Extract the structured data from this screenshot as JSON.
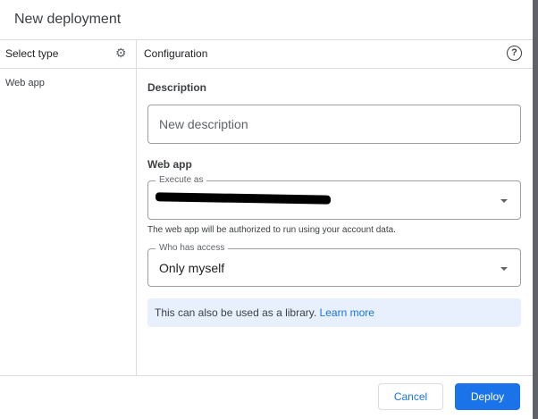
{
  "dialog": {
    "title": "New deployment"
  },
  "sidebar": {
    "header": "Select type",
    "items": [
      {
        "label": "Web app"
      }
    ]
  },
  "config": {
    "header": "Configuration",
    "description_label": "Description",
    "description_placeholder": "New description",
    "webapp_label": "Web app",
    "execute_as_label": "Execute as",
    "execute_as_hint": "The web app will be authorized to run using your account data.",
    "access_label": "Who has access",
    "access_value": "Only myself",
    "info_text": "This can also be used as a library.",
    "info_link": "Learn more"
  },
  "footer": {
    "cancel": "Cancel",
    "deploy": "Deploy"
  },
  "colors": {
    "accent": "#1a73e8",
    "info_bg": "#e8f0fe"
  }
}
